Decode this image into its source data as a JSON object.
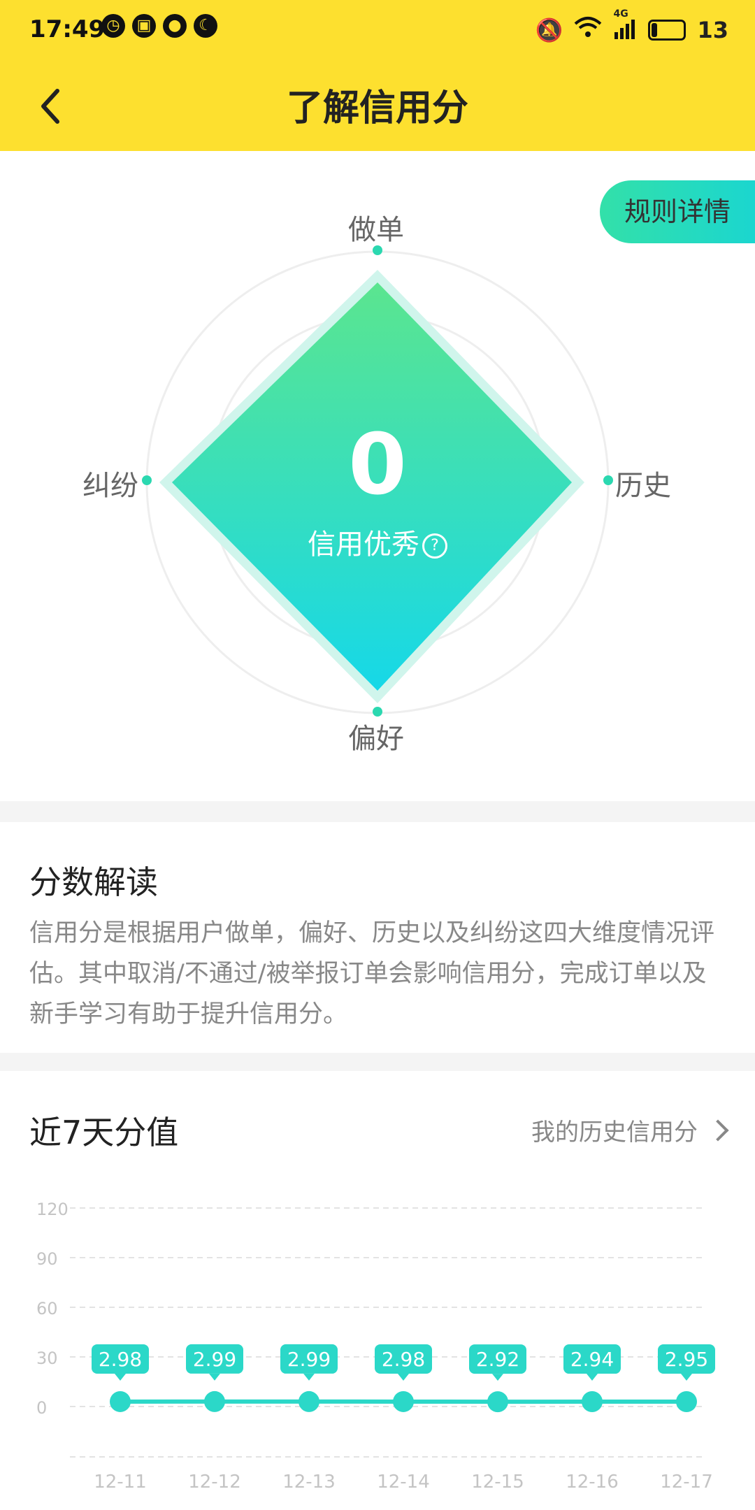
{
  "status_bar": {
    "time": "17:49",
    "battery": "13",
    "net": "4G"
  },
  "header": {
    "title": "了解信用分"
  },
  "radar": {
    "rule_button": "规则详情",
    "axes": [
      "做单",
      "历史",
      "偏好",
      "纠纷"
    ],
    "score": "0",
    "level": "信用优秀",
    "help": "?"
  },
  "explain": {
    "title": "分数解读",
    "text": "信用分是根据用户做单，偏好、历史以及纠纷这四大维度情况评估。其中取消/不通过/被举报订单会影响信用分，完成订单以及新手学习有助于提升信用分。"
  },
  "chart_section": {
    "title": "近7天分值",
    "history_link": "我的历史信用分"
  },
  "chart_data": {
    "type": "line",
    "x": [
      "12-11",
      "12-12",
      "12-13",
      "12-14",
      "12-15",
      "12-16",
      "12-17"
    ],
    "series": [
      {
        "values": [
          2.98,
          2.99,
          2.99,
          2.98,
          2.92,
          2.94,
          2.95
        ]
      }
    ],
    "data_labels": [
      "2.98",
      "2.99",
      "2.99",
      "2.98",
      "2.92",
      "2.94",
      "2.95"
    ],
    "y_ticks": [
      "0",
      "30",
      "60",
      "90",
      "120"
    ],
    "ylim": [
      0,
      120
    ],
    "grid": true,
    "color": "#2bd8c8"
  }
}
